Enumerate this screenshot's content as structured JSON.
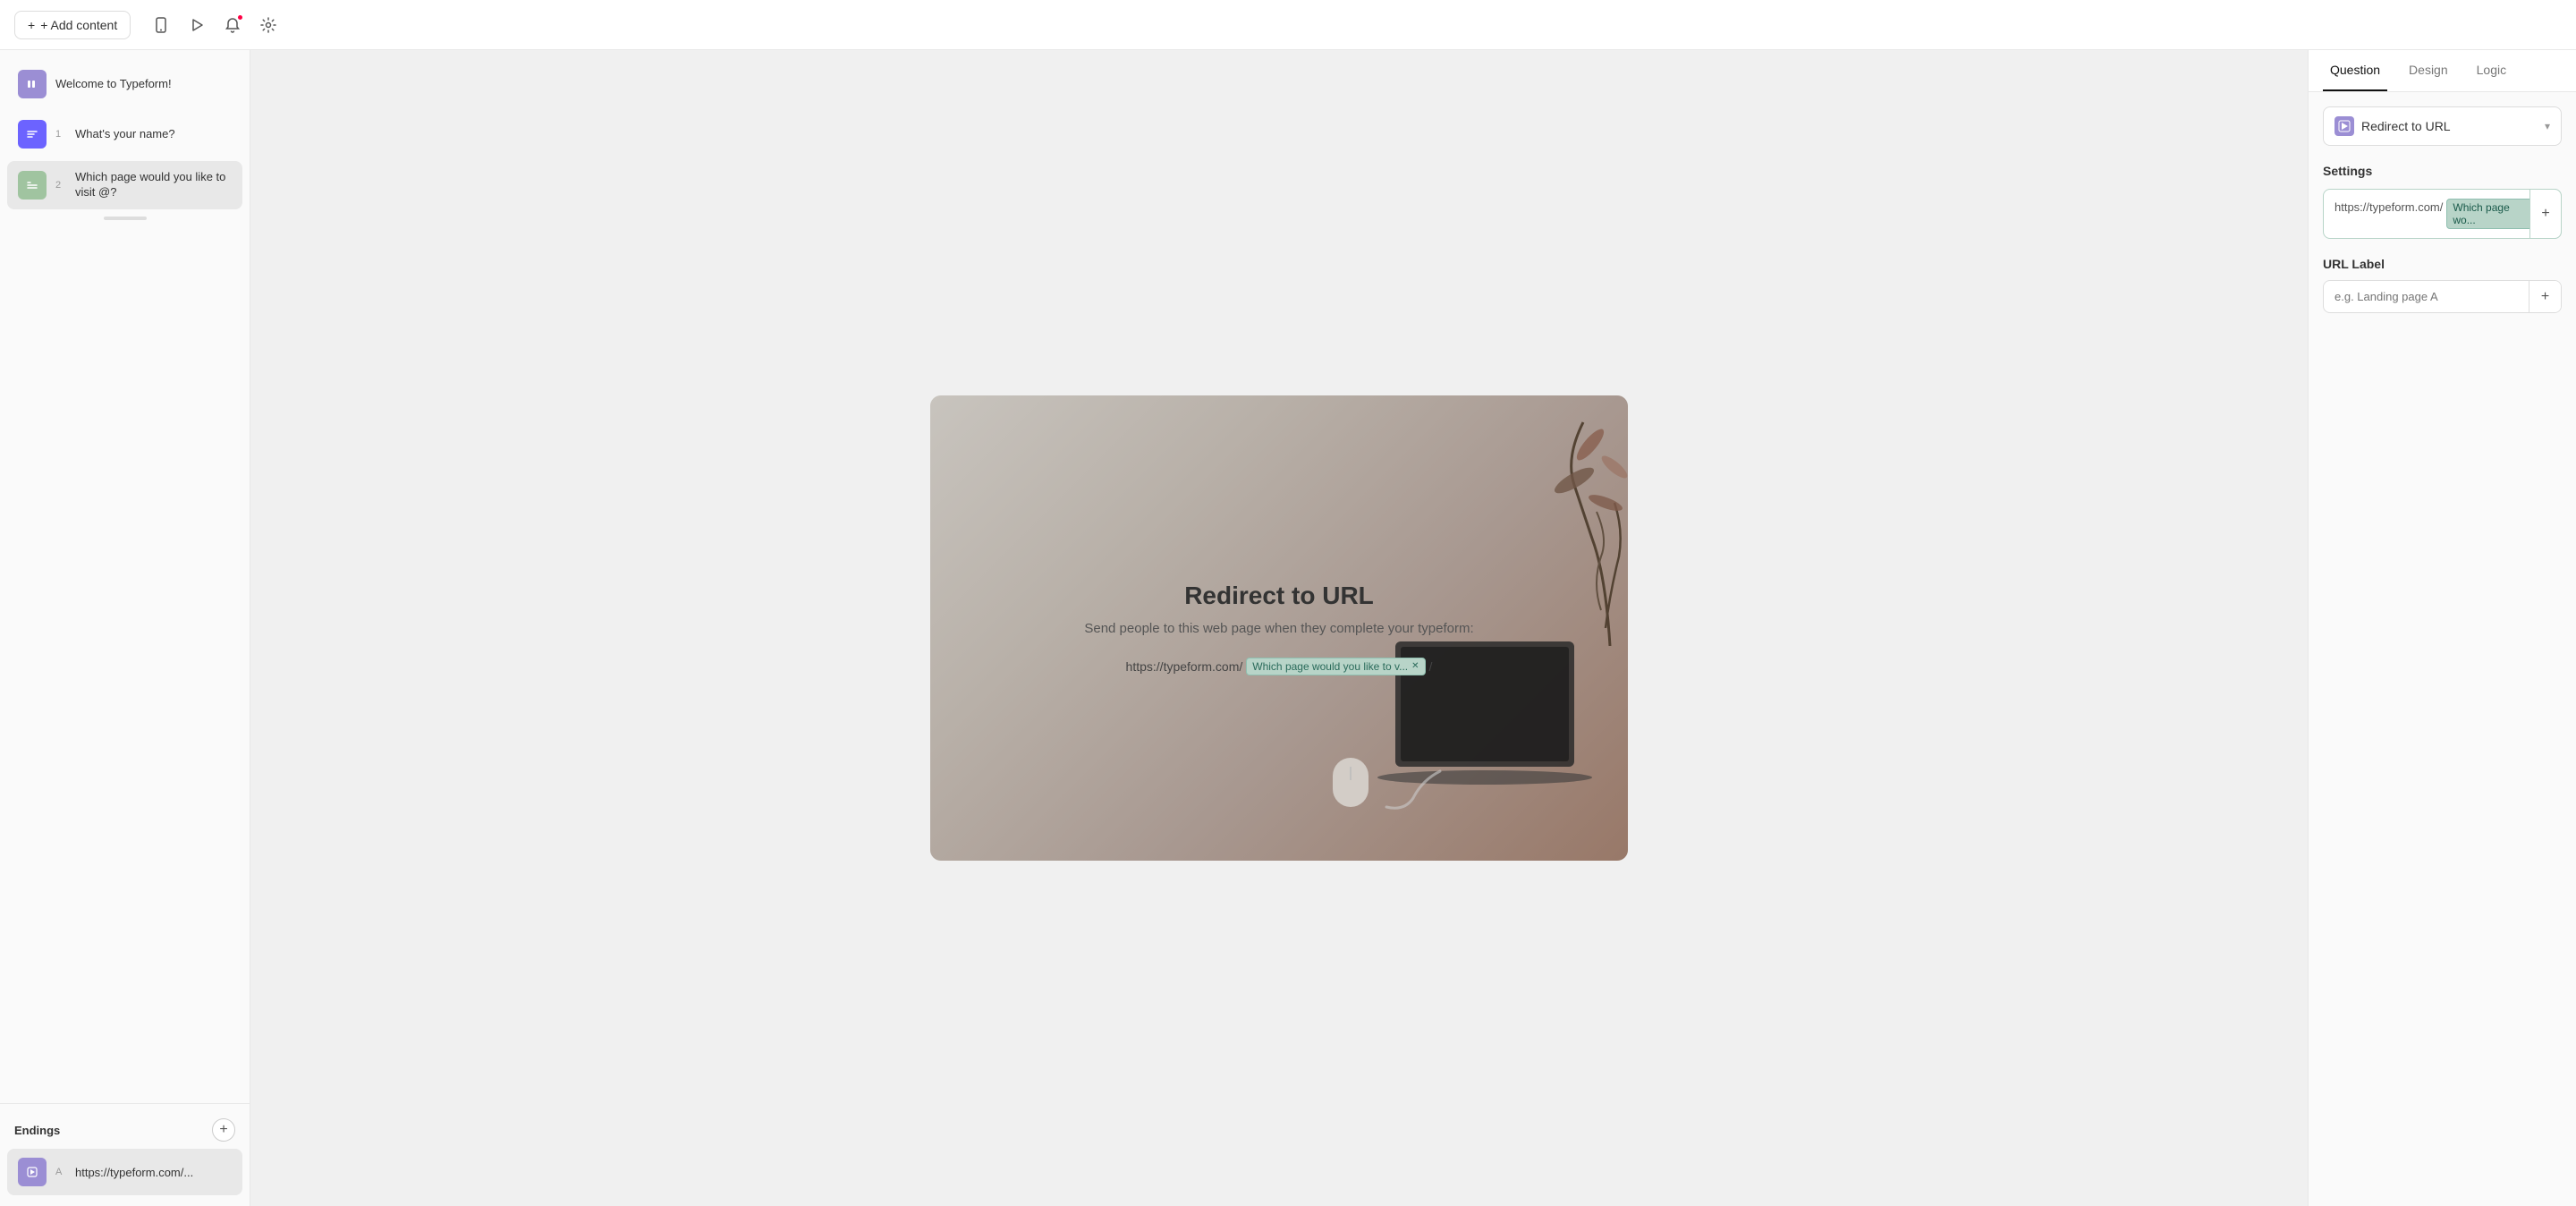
{
  "toolbar": {
    "add_content_label": "+ Add content",
    "play_icon": "▶",
    "mobile_icon": "📱",
    "notify_icon": "🔔",
    "settings_icon": "⚙"
  },
  "sidebar": {
    "questions": [
      {
        "id": "welcome",
        "badge_label": "❙❙",
        "badge_type": "welcome",
        "number": "",
        "text": "Welcome to Typeform!"
      },
      {
        "id": "name",
        "badge_label": "=",
        "badge_type": "name",
        "number": "1",
        "text": "What's your name?"
      },
      {
        "id": "which",
        "badge_label": "B=",
        "badge_type": "which",
        "number": "2",
        "text": "Which page would you like to visit @?"
      }
    ],
    "endings_title": "Endings",
    "endings": [
      {
        "id": "ending-a",
        "badge_label": "A",
        "text": "https://typeform.com/..."
      }
    ]
  },
  "canvas": {
    "preview_title": "Redirect to URL",
    "preview_subtitle": "Send people to this web page when they complete your typeform:",
    "url_base": "https://typeform.com/",
    "url_tag_label": "Which page would you like to v...",
    "url_slash": "/"
  },
  "right_panel": {
    "tabs": [
      {
        "id": "question",
        "label": "Question",
        "active": true
      },
      {
        "id": "design",
        "label": "Design",
        "active": false
      },
      {
        "id": "logic",
        "label": "Logic",
        "active": false
      }
    ],
    "redirect_dropdown": {
      "label": "Redirect to URL",
      "icon": "▷"
    },
    "settings_title": "Settings",
    "url_label_section_title": "URL Label",
    "url_base_text": "https://typeform.com/",
    "url_tag_text": "Which page wo...",
    "url_slash": "/",
    "url_label_placeholder": "e.g. Landing page A"
  }
}
